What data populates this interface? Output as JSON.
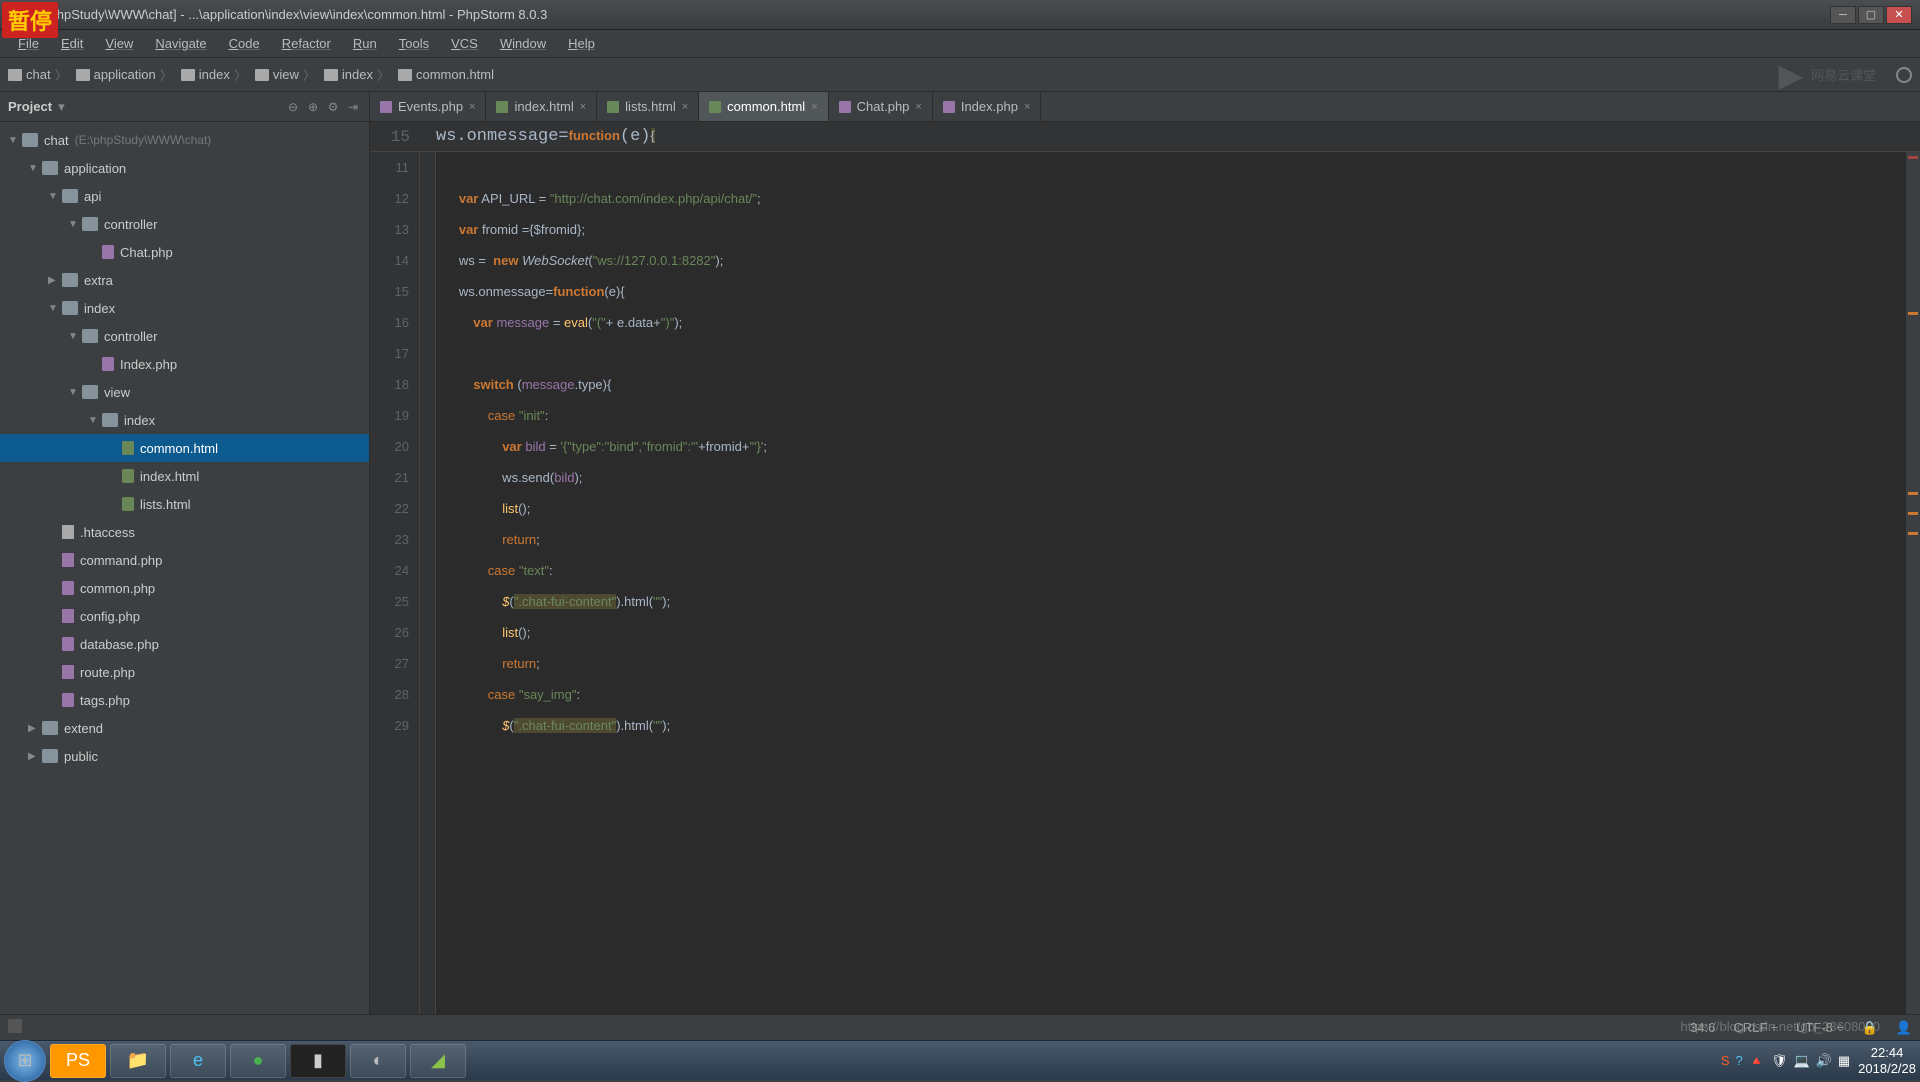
{
  "overlay": {
    "text": "暂停"
  },
  "title_bar": {
    "path": "[E:\\phpStudy\\WWW\\chat] - ...\\application\\index\\view\\index\\common.html - PhpStorm 8.0.3"
  },
  "menu": {
    "items": [
      "File",
      "Edit",
      "View",
      "Navigate",
      "Code",
      "Refactor",
      "Run",
      "Tools",
      "VCS",
      "Window",
      "Help"
    ]
  },
  "breadcrumbs": {
    "items": [
      "chat",
      "application",
      "index",
      "view",
      "index",
      "common.html"
    ],
    "watermark": "网易云课堂"
  },
  "project_panel": {
    "title": "Project",
    "tree": [
      {
        "name": "chat",
        "loc": "(E:\\phpStudy\\WWW\\chat)",
        "depth": 0,
        "arrow": "▼",
        "type": "folder"
      },
      {
        "name": "application",
        "depth": 1,
        "arrow": "▼",
        "type": "folder"
      },
      {
        "name": "api",
        "depth": 2,
        "arrow": "▼",
        "type": "folder"
      },
      {
        "name": "controller",
        "depth": 3,
        "arrow": "▼",
        "type": "folder"
      },
      {
        "name": "Chat.php",
        "depth": 4,
        "arrow": "",
        "type": "php"
      },
      {
        "name": "extra",
        "depth": 2,
        "arrow": "▶",
        "type": "folder"
      },
      {
        "name": "index",
        "depth": 2,
        "arrow": "▼",
        "type": "folder"
      },
      {
        "name": "controller",
        "depth": 3,
        "arrow": "▼",
        "type": "folder"
      },
      {
        "name": "Index.php",
        "depth": 4,
        "arrow": "",
        "type": "php"
      },
      {
        "name": "view",
        "depth": 3,
        "arrow": "▼",
        "type": "folder"
      },
      {
        "name": "index",
        "depth": 4,
        "arrow": "▼",
        "type": "folder"
      },
      {
        "name": "common.html",
        "depth": 5,
        "arrow": "",
        "type": "file",
        "selected": true
      },
      {
        "name": "index.html",
        "depth": 5,
        "arrow": "",
        "type": "file"
      },
      {
        "name": "lists.html",
        "depth": 5,
        "arrow": "",
        "type": "file"
      },
      {
        "name": ".htaccess",
        "depth": 2,
        "arrow": "",
        "type": "htaccess"
      },
      {
        "name": "command.php",
        "depth": 2,
        "arrow": "",
        "type": "php"
      },
      {
        "name": "common.php",
        "depth": 2,
        "arrow": "",
        "type": "php"
      },
      {
        "name": "config.php",
        "depth": 2,
        "arrow": "",
        "type": "php"
      },
      {
        "name": "database.php",
        "depth": 2,
        "arrow": "",
        "type": "php"
      },
      {
        "name": "route.php",
        "depth": 2,
        "arrow": "",
        "type": "php"
      },
      {
        "name": "tags.php",
        "depth": 2,
        "arrow": "",
        "type": "php"
      },
      {
        "name": "extend",
        "depth": 1,
        "arrow": "▶",
        "type": "folder"
      },
      {
        "name": "public",
        "depth": 1,
        "arrow": "▶",
        "type": "folder"
      }
    ]
  },
  "tabs": [
    {
      "label": "Events.php",
      "type": "php"
    },
    {
      "label": "index.html",
      "type": "file"
    },
    {
      "label": "lists.html",
      "type": "file"
    },
    {
      "label": "common.html",
      "type": "file",
      "active": true
    },
    {
      "label": "Chat.php",
      "type": "php"
    },
    {
      "label": "Index.php",
      "type": "php"
    }
  ],
  "sticky": {
    "num": "15",
    "code_html": "   ws.onmessage=<span class='kw'>function</span>(e)<span class='hl'>{</span>"
  },
  "code_lines": [
    {
      "num": 11,
      "html": ""
    },
    {
      "num": 12,
      "html": "   <span class='kw'>var</span> API_URL = <span class='str'>\"http://chat.com/index.php/api/chat/\"</span>;"
    },
    {
      "num": 13,
      "html": "   <span class='kw'>var</span> fromid ={$fromid};"
    },
    {
      "num": 14,
      "html": "   ws =  <span class='kw'>new</span> <span class='typ'>WebSocket</span>(<span class='str'>\"ws://127.0.0.1:8282\"</span>);"
    },
    {
      "num": 15,
      "html": "   ws.onmessage=<span class='kw'>function</span>(e){"
    },
    {
      "num": 16,
      "html": "       <span class='kw'>var</span> <span class='var'>message</span> = <span class='fn'>eval</span>(<span class='str'>\"(\"</span>+ e.data+<span class='str'>\")\"</span>);"
    },
    {
      "num": 17,
      "html": ""
    },
    {
      "num": 18,
      "html": "       <span class='kw'>switch</span> (<span class='var'>message</span>.type){"
    },
    {
      "num": 19,
      "html": "           <span class='kw2'>case</span> <span class='str'>\"init\"</span>:"
    },
    {
      "num": 20,
      "html": "               <span class='kw'>var</span> <span class='var'>bild</span> = <span class='str'>'{\"type\":\"bind\",\"fromid\":\"'</span>+fromid+<span class='str'>'\"}'</span>;"
    },
    {
      "num": 21,
      "html": "               ws.send(<span class='var'>bild</span>);"
    },
    {
      "num": 22,
      "html": "               <span class='fn'>list</span>();"
    },
    {
      "num": 23,
      "html": "               <span class='kw2'>return</span>;"
    },
    {
      "num": 24,
      "html": "           <span class='kw2'>case</span> <span class='str'>\"text\"</span>:"
    },
    {
      "num": 25,
      "html": "               <span class='jq'>$</span>(<span class='str hl'>\".chat-fui-content\"</span>).html(<span class='str'>\"\"</span>);"
    },
    {
      "num": 26,
      "html": "               <span class='fn'>list</span>();"
    },
    {
      "num": 27,
      "html": "               <span class='kw2'>return</span>;"
    },
    {
      "num": 28,
      "html": "           <span class='kw2'>case</span> <span class='str'>\"say_img\"</span>:"
    },
    {
      "num": 29,
      "html": "               <span class='jq'>$</span>(<span class='str hl'>\".chat-fui-content\"</span>).html(<span class='str'>\"\"</span>);"
    }
  ],
  "status": {
    "position": "34:6",
    "line_ending": "CRLF ÷",
    "encoding": "UTF-8 ÷",
    "lock": "🔒"
  },
  "taskbar": {
    "clock_time": "22:44",
    "clock_date": "2018/2/28",
    "url_watermark": "https://blog.csdn.net/gb_23608000"
  }
}
